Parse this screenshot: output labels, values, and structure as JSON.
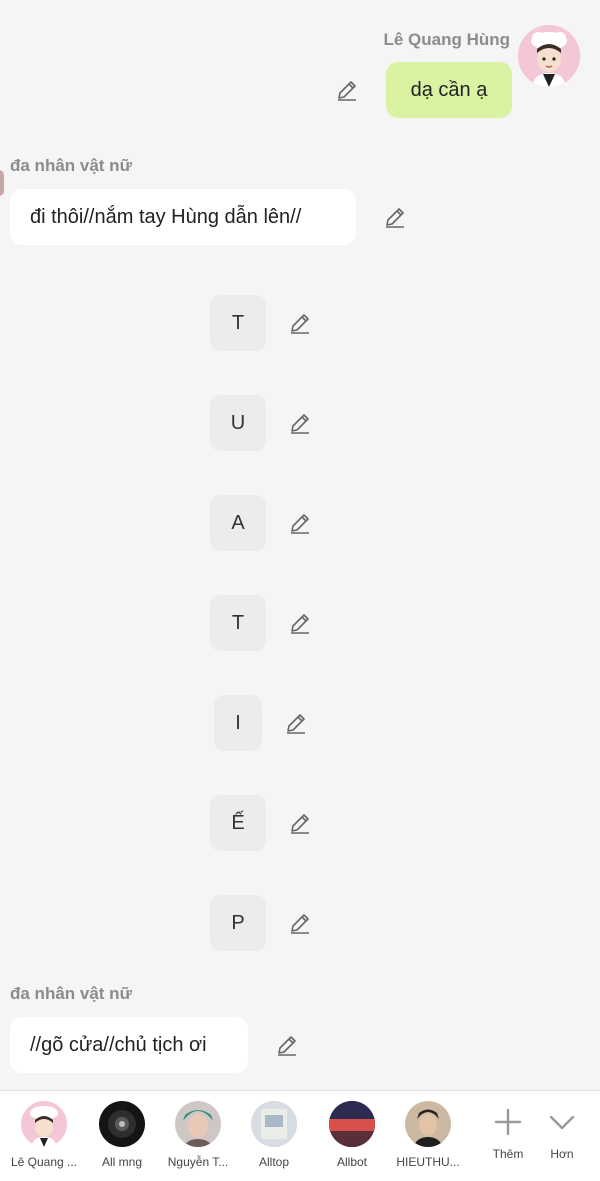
{
  "messages": {
    "msg1": {
      "sender": "Lê Quang Hùng",
      "text": "dạ cần ạ"
    },
    "msg2": {
      "sender": "đa nhân vật nữ",
      "text": "đi thôi//nắm tay Hùng dẫn lên//"
    },
    "letters": [
      "T",
      "U",
      "A",
      "T",
      "I",
      "Ế",
      "P"
    ],
    "msg3": {
      "sender": "đa nhân vật nữ",
      "text": "//gõ cửa//chủ tịch ơi"
    }
  },
  "bottom_bar": {
    "characters": [
      {
        "label": "Lê Quang ..."
      },
      {
        "label": "All mng"
      },
      {
        "label": "Nguyễn T..."
      },
      {
        "label": "Alltop"
      },
      {
        "label": "Allbot"
      },
      {
        "label": "HIEUTHU..."
      }
    ],
    "add_label": "Thêm",
    "more_label": "Hơn"
  },
  "colors": {
    "background": "#f5f5f5",
    "user_bubble": "#d9f3a3",
    "bot_bubble": "#ffffff",
    "letter_tile": "#ececec",
    "sender_name": "#8c8c8c"
  },
  "icons": [
    "edit-icon",
    "plus-icon",
    "chevron-down-icon"
  ]
}
